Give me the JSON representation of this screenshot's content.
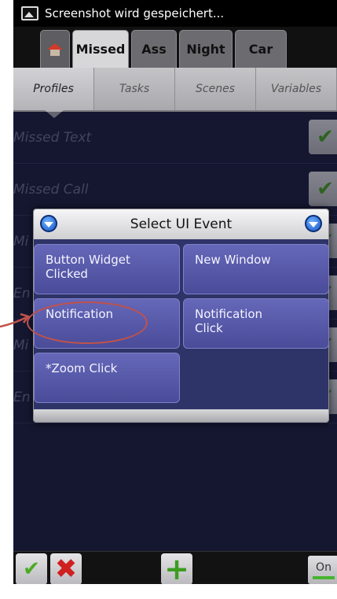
{
  "status_bar": {
    "text": "Screenshot wird gespeichert...",
    "icon": "screenshot-icon"
  },
  "project_tabs": [
    {
      "label": "",
      "icon": "home-icon"
    },
    {
      "label": "Missed",
      "active": true
    },
    {
      "label": "Ass"
    },
    {
      "label": "Night"
    },
    {
      "label": "Car"
    }
  ],
  "section_tabs": [
    {
      "label": "Profiles",
      "active": true
    },
    {
      "label": "Tasks"
    },
    {
      "label": "Scenes"
    },
    {
      "label": "Variables"
    }
  ],
  "profiles": [
    {
      "name": "Missed Text",
      "enabled": true
    },
    {
      "name": "Missed Call",
      "enabled": true
    },
    {
      "name": "Mi",
      "enabled": true
    },
    {
      "name": "En",
      "enabled": true
    },
    {
      "name": "Mi",
      "enabled": true
    },
    {
      "name": "En",
      "enabled": true
    }
  ],
  "dialog": {
    "title": "Select UI Event",
    "events": [
      {
        "line1": "Button Widget",
        "line2": "Clicked"
      },
      {
        "line1": "New Window",
        "line2": ""
      },
      {
        "line1": "Notification",
        "line2": ""
      },
      {
        "line1": "Notification",
        "line2": "Click"
      },
      {
        "line1": "*Zoom Click",
        "line2": ""
      }
    ]
  },
  "bottom_bar": {
    "toggle_label": "On"
  },
  "colors": {
    "screen_bg": "#1e2240",
    "dialog_bg": "#2f3468",
    "event_button": "#5a5cab",
    "annotation": "#c0524a",
    "check_green": "#4caa24",
    "delete_red": "#d01f1f"
  }
}
